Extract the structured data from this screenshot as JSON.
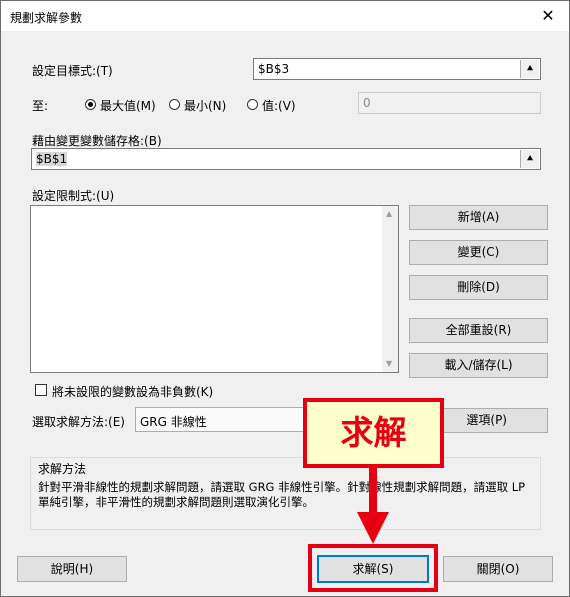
{
  "window": {
    "title": "規劃求解參數",
    "close_glyph": "✕"
  },
  "objective": {
    "label": "設定目標式:(T)",
    "value": "$B$3",
    "ref_glyph": "⯅"
  },
  "to": {
    "label": "至:",
    "options": [
      "最大值(M)",
      "最小(N)",
      "值:(V)"
    ],
    "selected": "最大值(M)",
    "value_of": "0"
  },
  "variables": {
    "label": "藉由變更變數儲存格:(B)",
    "value": "$B$1",
    "ref_glyph": "⯅"
  },
  "constraints": {
    "label": "設定限制式:(U)",
    "up_glyph": "▲",
    "down_glyph": "▼"
  },
  "side_buttons": {
    "add": "新增(A)",
    "change": "變更(C)",
    "delete": "刪除(D)",
    "reset_all": "全部重設(R)",
    "load_save": "載入/儲存(L)"
  },
  "nonneg": {
    "label": "將未設限的變數設為非負數(K)",
    "checked": false
  },
  "method": {
    "label": "選取求解方法:(E)",
    "selected": "GRG 非線性",
    "options_button": "選項(P)"
  },
  "method_group": {
    "title": "求解方法",
    "description": "針對平滑非線性的規劃求解問題，請選取 GRG 非線性引擎。針對線性規劃求解問題，請選取 LP 單純引擎，非平滑性的規劃求解問題則選取演化引擎。"
  },
  "bottom": {
    "help": "說明(H)",
    "solve": "求解(S)",
    "close": "關閉(O)"
  },
  "annotation": {
    "callout_text": "求解",
    "color": "#e60012",
    "callout_bg": "#ffffcc"
  }
}
